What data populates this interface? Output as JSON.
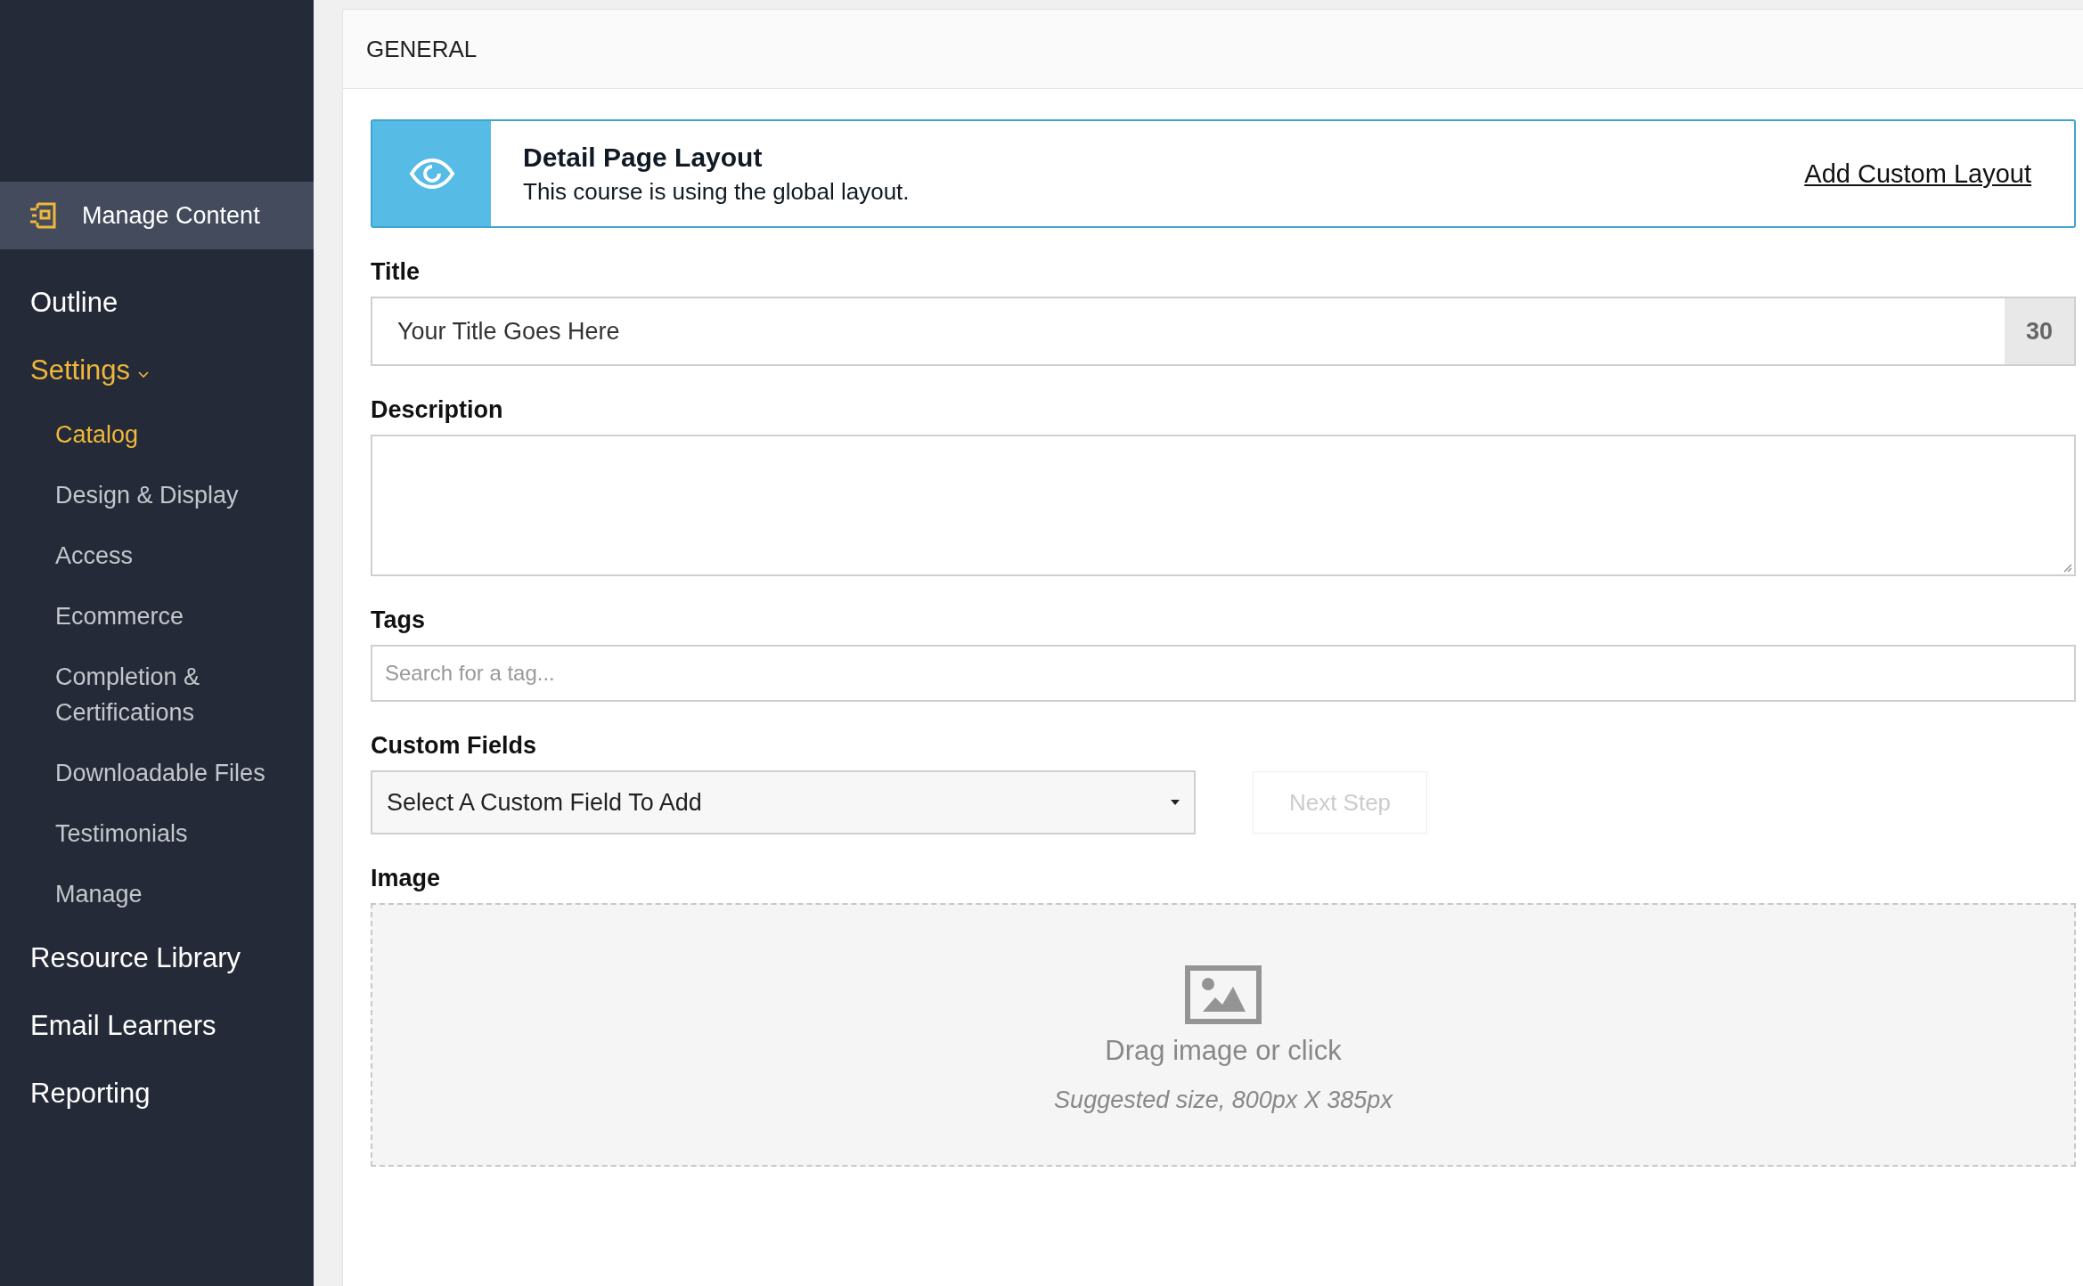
{
  "sidebar": {
    "header": {
      "label": "Manage Content",
      "selected": true
    },
    "items": [
      {
        "label": "Outline",
        "selected": false
      },
      {
        "label": "Settings",
        "selected": true,
        "expanded": true,
        "children": [
          {
            "label": "Catalog",
            "selected": true
          },
          {
            "label": "Design & Display",
            "selected": false
          },
          {
            "label": "Access",
            "selected": false
          },
          {
            "label": "Ecommerce",
            "selected": false
          },
          {
            "label": "Completion & Certifications",
            "selected": false
          },
          {
            "label": "Downloadable Files",
            "selected": false
          },
          {
            "label": "Testimonials",
            "selected": false
          },
          {
            "label": "Manage",
            "selected": false
          }
        ]
      },
      {
        "label": "Resource Library",
        "selected": false
      },
      {
        "label": "Email Learners",
        "selected": false
      },
      {
        "label": "Reporting",
        "selected": false
      }
    ]
  },
  "section": {
    "title": "GENERAL"
  },
  "layout_banner": {
    "title": "Detail Page Layout",
    "text": "This course is using the global layout.",
    "link": "Add Custom Layout"
  },
  "title_field": {
    "label": "Title",
    "value": "Your Title Goes Here",
    "counter": "30"
  },
  "description_field": {
    "label": "Description"
  },
  "tags_field": {
    "label": "Tags",
    "placeholder": "Search for a tag..."
  },
  "custom_fields": {
    "label": "Custom Fields",
    "select": "Select A Custom Field To Add",
    "button": {
      "label": "Next Step",
      "disabled": true
    }
  },
  "image_field": {
    "label": "Image",
    "text": "Drag image or click",
    "hint": "Suggested size, 800px X 385px"
  }
}
